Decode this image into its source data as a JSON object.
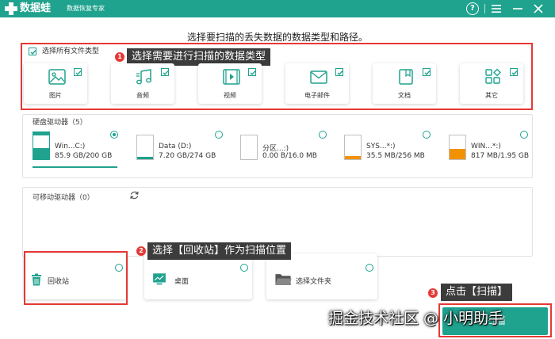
{
  "app": {
    "name": "数据蛙",
    "subtitle": "数据恢复专家",
    "colors": {
      "accent": "#1fa28e",
      "callout": "#e53935",
      "label_bg": "#3c3c3c"
    },
    "window_controls": [
      "help-icon",
      "menu-icon",
      "minimize-icon",
      "close-icon"
    ],
    "help_glyph": "?"
  },
  "heading": "选择要扫描的丢失数据的数据类型和路径。",
  "file_types": {
    "select_all_label": "选择所有文件类型",
    "select_all_checked": true,
    "items": [
      {
        "label": "图片",
        "icon": "image-icon",
        "checked": true
      },
      {
        "label": "音频",
        "icon": "music-icon",
        "checked": true
      },
      {
        "label": "视频",
        "icon": "video-icon",
        "checked": true
      },
      {
        "label": "电子邮件",
        "icon": "email-icon",
        "checked": true
      },
      {
        "label": "文档",
        "icon": "document-icon",
        "checked": true
      },
      {
        "label": "其它",
        "icon": "grid-icon",
        "checked": true
      }
    ]
  },
  "hard_drives": {
    "title": "硬盘驱动器（5）",
    "items": [
      {
        "name": "Win...C:)",
        "size": "85.9 GB/200 GB",
        "fill": 0.43,
        "selected": true,
        "style": "system"
      },
      {
        "name": "Data (D:)",
        "size": "7.20 GB/274 GB",
        "fill": 0.03,
        "selected": false,
        "style": "plain"
      },
      {
        "name": "分区...:)",
        "size": "0.00  B/16.0 MB",
        "fill": 0.0,
        "selected": false,
        "style": "plain"
      },
      {
        "name": "SYS...*:)",
        "size": "35.5 MB/256 MB",
        "fill": 0.14,
        "selected": false,
        "style": "orange"
      },
      {
        "name": "WIN...*:)",
        "size": "817 MB/1.95 GB",
        "fill": 0.42,
        "selected": false,
        "style": "orange"
      }
    ]
  },
  "removable": {
    "title": "可移动驱动器（0）",
    "refresh_icon": "refresh-icon"
  },
  "locations": [
    {
      "label": "回收站",
      "icon": "recycle-bin-icon",
      "selected": false
    },
    {
      "label": "桌面",
      "icon": "desktop-icon",
      "selected": false
    },
    {
      "label": "选择文件夹",
      "icon": "folder-icon",
      "selected": false
    }
  ],
  "callouts": [
    {
      "number": "1",
      "text": "选择需要进行扫描的数据类型"
    },
    {
      "number": "2",
      "text": "选择【回收站】作为扫描位置"
    },
    {
      "number": "3",
      "text": "点击【扫描】"
    }
  ],
  "scan_button": "扫描",
  "watermark": "掘金技术社区 @ 小明助手"
}
